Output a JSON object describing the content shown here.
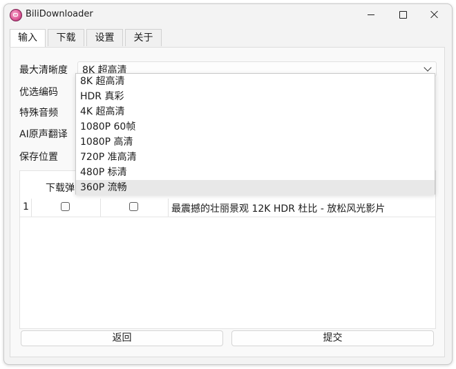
{
  "window": {
    "title": "BiliDownloader",
    "app_icon": "bilibili-tv-icon"
  },
  "tabs": [
    {
      "label": "输入",
      "active": true
    },
    {
      "label": "下载",
      "active": false
    },
    {
      "label": "设置",
      "active": false
    },
    {
      "label": "关于",
      "active": false
    }
  ],
  "form": {
    "max_quality_label": "最大清晰度",
    "max_quality_value": "8K 超高清",
    "preferred_codec_label": "优选编码",
    "special_audio_label": "特殊音频",
    "ai_translate_label": "AI原声翻译",
    "save_location_label": "保存位置"
  },
  "quality_options": [
    "8K 超高清",
    "HDR 真彩",
    "4K 超高清",
    "1080P 60帧",
    "1080P 高清",
    "720P 准高清",
    "480P 标清",
    "360P 流畅"
  ],
  "highlighted_option_index": 7,
  "table": {
    "columns": [
      "下载弹"
    ],
    "rows": [
      {
        "index": "1",
        "download_danmaku": false,
        "second_check": false,
        "title": "最震撼的壮丽景观 12K HDR 杜比 - 放松风光影片"
      }
    ]
  },
  "buttons": {
    "back": "返回",
    "submit": "提交"
  },
  "colors": {
    "accent": "#0067c0",
    "highlight": "#e8e8e8"
  }
}
